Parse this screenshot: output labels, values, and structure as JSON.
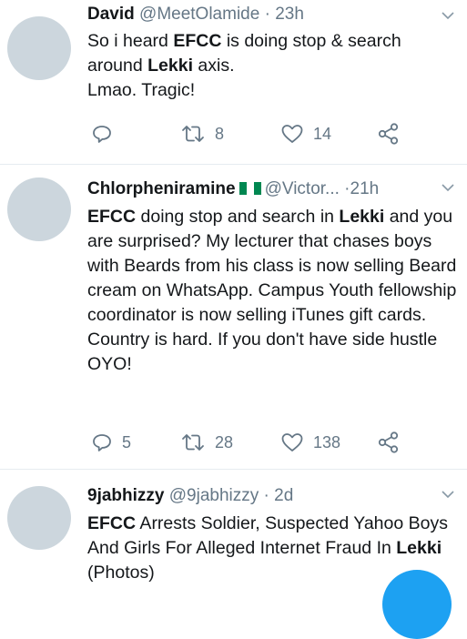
{
  "tweets": [
    {
      "name": "David",
      "handle": "@MeetOlamide",
      "dot": "·",
      "time": "23h",
      "flag": false,
      "text_html": "So i heard <b>EFCC</b> is doing stop &amp; search around <b>Lekki</b> axis.<br>Lmao. Tragic!",
      "reply_count": "",
      "retweet_count": "8",
      "like_count": "14"
    },
    {
      "name": "Chlorpheniramine",
      "handle": "@Victor...",
      "dot": "·",
      "time": "21h",
      "flag": true,
      "text_html": "<b>EFCC</b> doing stop and search in <b>Lekki</b> and you are surprised? My lecturer that chases boys with Beards from his class is now selling Beard cream on WhatsApp. Campus Youth fellowship coordinator is now selling iTunes gift cards. Country is hard. If you don't have side hustle OYO!",
      "reply_count": "5",
      "retweet_count": "28",
      "like_count": "138"
    },
    {
      "name": "9jabhizzy",
      "handle": "@9jabhizzy",
      "dot": "·",
      "time": "2d",
      "flag": false,
      "text_html": "<b>EFCC</b> Arrests Soldier, Suspected Yahoo Boys And Girls For Alleged Internet Fraud In <b>Lekki</b> (Photos)"
    }
  ],
  "icons": {
    "reply": "reply-icon",
    "retweet": "retweet-icon",
    "like": "heart-icon",
    "share": "share-icon",
    "caret": "chevron-down-icon"
  },
  "colors": {
    "text": "#14171a",
    "muted": "#657786",
    "avatar": "#ccd6dd",
    "divider": "#e6ecf0",
    "accent": "#1da1f2",
    "flag_green": "#008751"
  }
}
